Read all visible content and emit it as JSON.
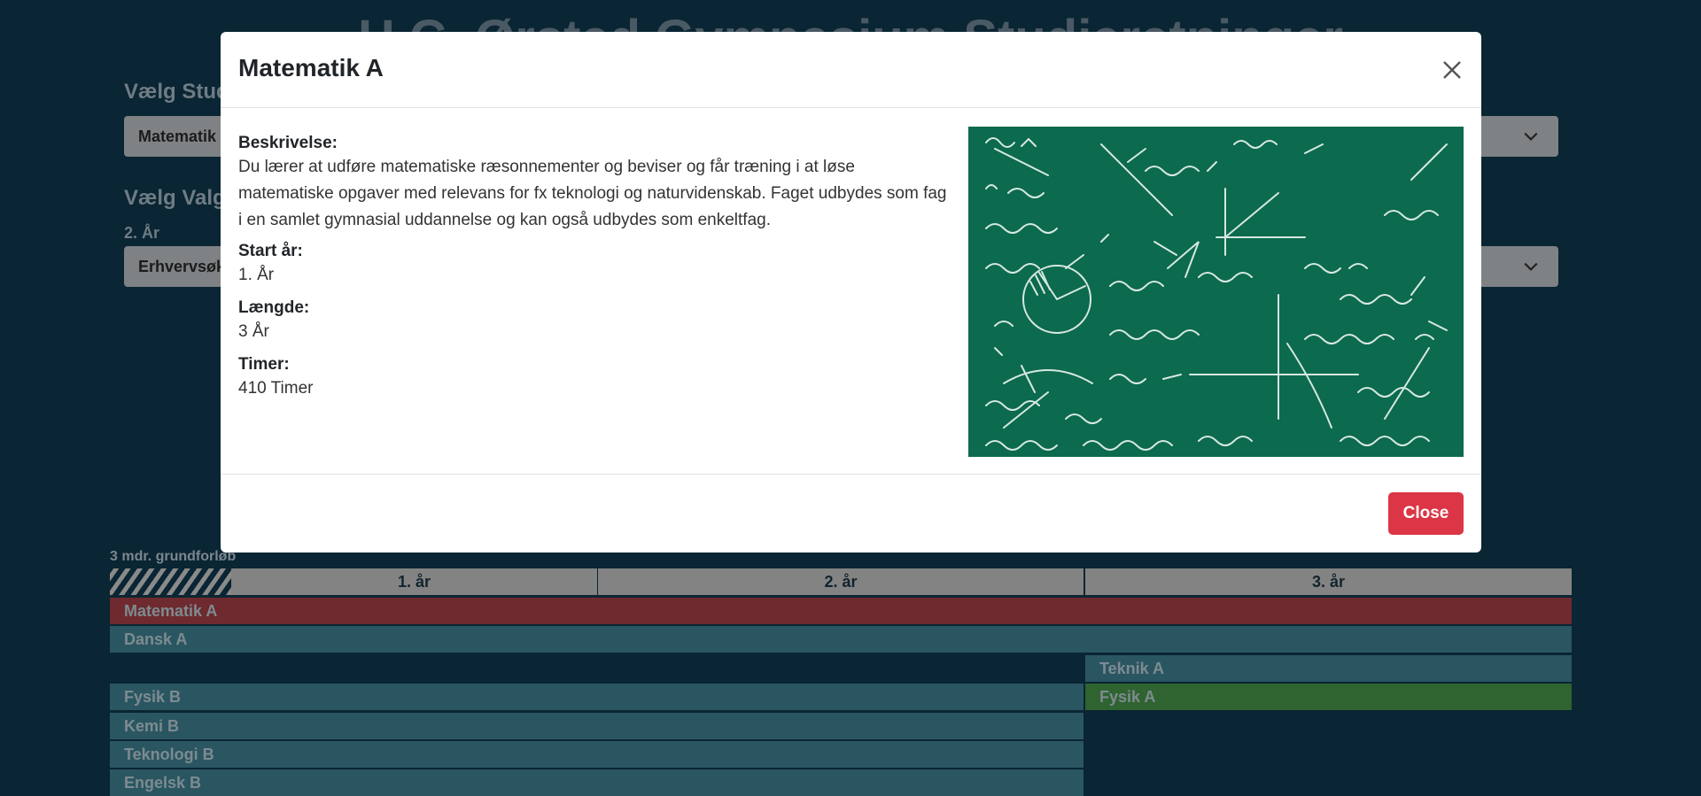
{
  "page": {
    "title": "H.C. Ørsted Gymnasium Studieretninger",
    "study_section_label": "Vælg Studieretning",
    "study_select_value": "Matematik",
    "elective_section_label": "Vælg Valgfag",
    "year_label": "2. År",
    "elective_select_value": "Erhvervsøkonomi"
  },
  "timeline": {
    "grund_label": "3 mdr. grundforløb",
    "years": [
      "1. år",
      "2. år",
      "3. år"
    ],
    "subjects": {
      "matematik_a": "Matematik A",
      "dansk_a": "Dansk A",
      "teknik_a": "Teknik A",
      "fysik_b": "Fysik B",
      "fysik_a": "Fysik A",
      "kemi_b": "Kemi B",
      "teknologi_b": "Teknologi B",
      "engelsk_b": "Engelsk B"
    }
  },
  "modal": {
    "title": "Matematik A",
    "description_label": "Beskrivelse:",
    "description": "Du lærer at udføre matematiske ræsonnementer og beviser og får træning i at løse matematiske opgaver med relevans for fx teknologi og naturvidenskab. Faget udbydes som fag i en samlet gymnasial uddannelse og kan også udbydes som enkeltfag.",
    "start_label": "Start år:",
    "start_value": "1. År",
    "length_label": "Længde:",
    "length_value": "3 År",
    "hours_label": "Timer:",
    "hours_value": "410 Timer",
    "close_button": "Close"
  },
  "colors": {
    "background": "#0a2533",
    "bar_teal": "#2a5662",
    "bar_red": "#6e2a2e",
    "bar_green": "#2f6330",
    "button_danger": "#dc3545",
    "chalkboard": "#0c6a4e"
  },
  "icons": {
    "close": "close-x-icon",
    "select_chevron": "chevron-down-icon"
  }
}
